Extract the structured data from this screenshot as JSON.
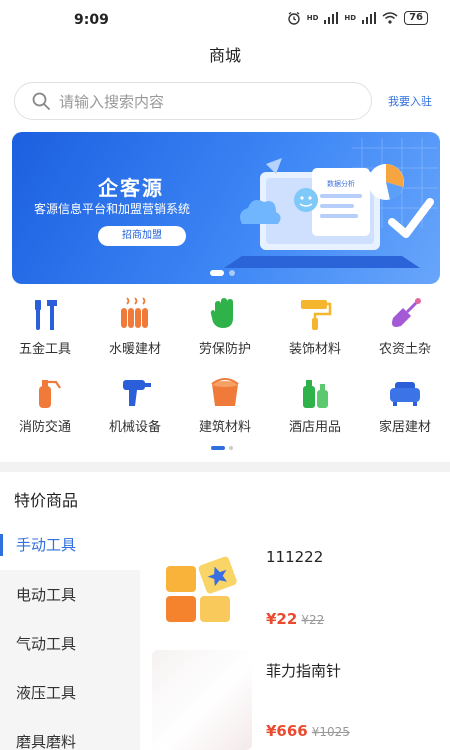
{
  "status_bar": {
    "time": "9:09",
    "signal1": "HD",
    "signal2": "HD",
    "battery": "76"
  },
  "header": {
    "title": "商城"
  },
  "search": {
    "placeholder": "请输入搜索内容",
    "join_label": "我要入驻"
  },
  "banner": {
    "title": "企客源",
    "subtitle": "客源信息平台和加盟营销系统",
    "button_label": "招商加盟",
    "screen_label": "数据分析"
  },
  "categories": [
    {
      "label": "五金工具",
      "icon": "wrench-icon"
    },
    {
      "label": "水暖建材",
      "icon": "radiator-icon"
    },
    {
      "label": "劳保防护",
      "icon": "glove-icon"
    },
    {
      "label": "装饰材料",
      "icon": "paint-roller-icon"
    },
    {
      "label": "农资土杂",
      "icon": "shovel-icon"
    },
    {
      "label": "消防交通",
      "icon": "fire-extinguisher-icon"
    },
    {
      "label": "机械设备",
      "icon": "drill-icon"
    },
    {
      "label": "建筑材料",
      "icon": "paint-bucket-icon"
    },
    {
      "label": "酒店用品",
      "icon": "bottles-icon"
    },
    {
      "label": "家居建材",
      "icon": "sofa-icon"
    }
  ],
  "specials": {
    "title": "特价商品",
    "nav": [
      "手动工具",
      "电动工具",
      "气动工具",
      "液压工具",
      "磨具磨料"
    ],
    "products": [
      {
        "name": "111222",
        "price": "¥22",
        "old_price": "¥22"
      },
      {
        "name": "菲力指南针",
        "price": "¥666",
        "old_price": "¥1025"
      }
    ]
  },
  "colors": {
    "accent": "#2f6fde",
    "price": "#ea4a2e",
    "banner": "#1c5fe0"
  }
}
